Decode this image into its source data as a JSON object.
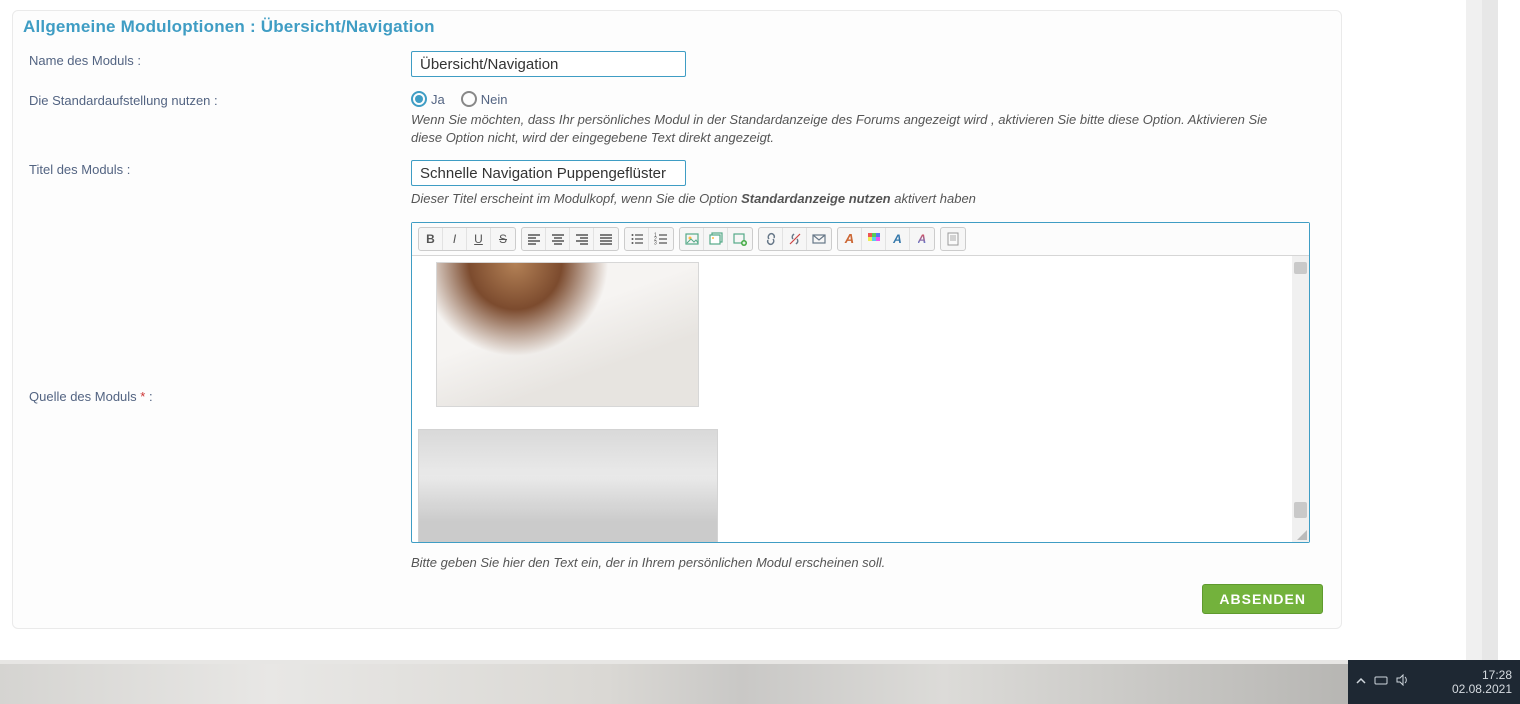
{
  "heading_prefix": "Allgemeine Moduloptionen : ",
  "heading_name": "Übersicht/Navigation",
  "labels": {
    "name": "Name des Moduls :",
    "std_layout": "Die Standardaufstellung nutzen :",
    "title": "Titel des Moduls :",
    "source": "Quelle des Moduls ",
    "required_marker": "*",
    "colon": " :"
  },
  "inputs": {
    "module_name": "Übersicht/Navigation",
    "module_title": "Schnelle Navigation Puppengeflüster"
  },
  "radio": {
    "yes": "Ja",
    "no": "Nein",
    "selected": "yes"
  },
  "descriptions": {
    "std_layout": "Wenn Sie möchten, dass Ihr persönliches Modul in der Standardanzeige des Forums angezeigt wird , aktivieren Sie bitte diese Option. Aktivieren Sie diese Option nicht, wird der eingegebene Text direkt angezeigt.",
    "title_pre": "Dieser Titel erscheint im Modulkopf, wenn Sie die Option ",
    "title_strong": "Standardanzeige nutzen",
    "title_post": " aktivert haben",
    "editor_hint": "Bitte geben Sie hier den Text ein, der in Ihrem persönlichen Modul erscheinen soll."
  },
  "toolbar": {
    "bold": "B",
    "italic": "I",
    "underline": "U",
    "strike": "S"
  },
  "submit_label": "ABSENDEN",
  "taskbar": {
    "time": "17:28",
    "date": "02.08.2021"
  }
}
